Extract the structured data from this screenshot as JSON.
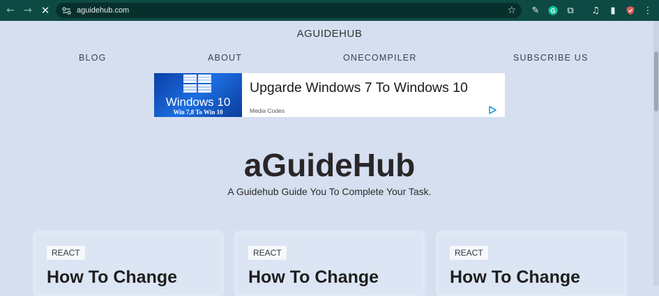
{
  "browser": {
    "url": "aguidehub.com",
    "back_icon": "←",
    "forward_icon": "→",
    "stop_icon": "✕",
    "star_icon": "☆",
    "extensions": [
      {
        "name": "eyedropper-icon",
        "glyph": "✎"
      },
      {
        "name": "grammarly-icon",
        "glyph": "G"
      },
      {
        "name": "extensions-puzzle-icon",
        "glyph": "⧉"
      },
      {
        "name": "media-controls-icon",
        "glyph": "♫"
      },
      {
        "name": "side-panel-icon",
        "glyph": "▮"
      },
      {
        "name": "profile-shield-icon",
        "glyph": "⛉"
      },
      {
        "name": "menu-kebab-icon",
        "glyph": "⋮"
      }
    ]
  },
  "site": {
    "title": "AGUIDEHUB",
    "nav": [
      "BLOG",
      "ABOUT",
      "ONECOMPILER",
      "SUBSCRIBE US"
    ]
  },
  "ad": {
    "image_title": "Windows 10",
    "image_subtitle": "Win 7,8 To Win 10",
    "headline": "Upgarde Windows 7 To Windows 10",
    "source": "Media Codes"
  },
  "hero": {
    "title": "aGuideHub",
    "subtitle": "A Guidehub Guide You To Complete Your Task."
  },
  "cards": [
    {
      "tag": "REACT",
      "title": "How To Change"
    },
    {
      "tag": "REACT",
      "title": "How To Change"
    },
    {
      "tag": "REACT",
      "title": "How To Change"
    }
  ],
  "colors": {
    "toolbar": "#0d4a43",
    "page_background": "#d5dff0",
    "ad_blue": "#1c6ee0"
  }
}
